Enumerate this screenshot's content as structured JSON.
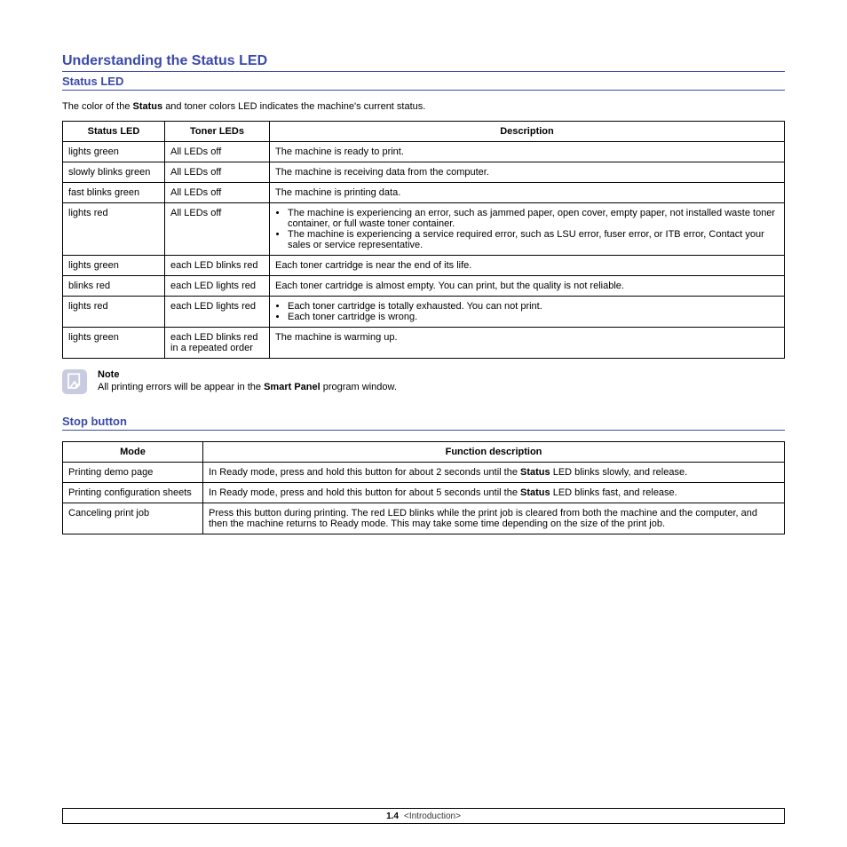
{
  "section1": {
    "title": "Understanding the Status LED",
    "subtitle": "Status LED",
    "intro": {
      "pre": "The color of the ",
      "bold": "Status",
      "post": " and toner colors LED indicates the machine's current status."
    },
    "headers": [
      "Status LED",
      "Toner LEDs",
      "Description"
    ],
    "rows": [
      {
        "c1": "lights green",
        "c2": "All LEDs off",
        "c3": "The machine is ready to print."
      },
      {
        "c1": "slowly blinks green",
        "c2": "All LEDs off",
        "c3": "The machine is receiving data from the computer."
      },
      {
        "c1": "fast blinks green",
        "c2": "All LEDs off",
        "c3": "The machine is printing data."
      },
      {
        "c1": "lights red",
        "c2": "All LEDs off",
        "c3list": [
          "The machine is experiencing an error, such as jammed paper, open cover, empty paper, not installed waste toner container, or full waste toner container.",
          "The machine is experiencing a service required error, such as LSU error, fuser error, or ITB error, Contact your sales or service representative."
        ]
      },
      {
        "c1": "lights green",
        "c2": "each LED blinks red",
        "c3": "Each toner cartridge is near the end of its life."
      },
      {
        "c1": "blinks red",
        "c2": "each LED lights red",
        "c3": "Each toner cartridge is almost empty. You can print, but the quality is not reliable."
      },
      {
        "c1": "lights red",
        "c2": "each LED lights red",
        "c3list": [
          "Each toner cartridge is totally exhausted. You can not print.",
          "Each toner cartridge is wrong."
        ]
      },
      {
        "c1": "lights green",
        "c2": "each LED blinks red in a repeated order",
        "c3": "The machine is warming up."
      }
    ],
    "note": {
      "label": "Note",
      "pre": "All printing errors will be appear in the ",
      "bold": "Smart Panel",
      "post": " program window."
    }
  },
  "section2": {
    "title": "Stop button",
    "headers": [
      "Mode",
      "Function description"
    ],
    "rows": [
      {
        "c1": "Printing demo page",
        "c2": {
          "pre": "In Ready mode, press and hold this button for about 2 seconds until the ",
          "bold": "Status",
          "post": " LED blinks slowly, and release."
        }
      },
      {
        "c1": "Printing configuration sheets",
        "c2": {
          "pre": "In Ready mode, press and hold this button for about 5 seconds until the ",
          "bold": "Status",
          "post": " LED blinks fast, and release."
        }
      },
      {
        "c1": "Canceling print job",
        "c2plain": "Press this button during printing. The red LED blinks while the print job is cleared from both the machine and the computer, and then the machine returns to Ready mode. This may take some time depending on the size of the print job."
      }
    ]
  },
  "footer": {
    "page_prefix_bold": "1",
    "page_suffix": ".4",
    "chapter": "<Introduction>"
  }
}
